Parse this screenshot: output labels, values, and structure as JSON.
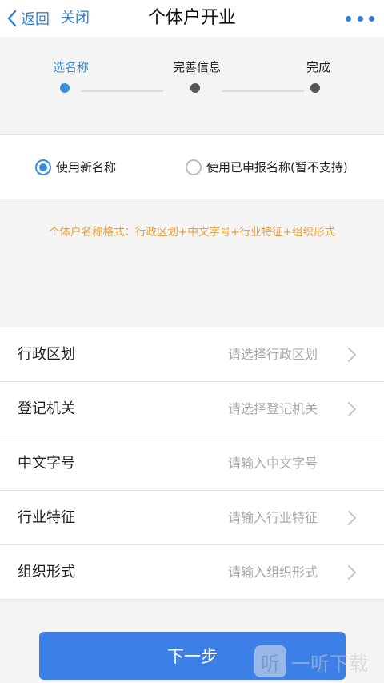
{
  "navbar": {
    "back_label": "返回",
    "close_label": "关闭",
    "title": "个体户开业"
  },
  "steps": [
    {
      "label": "选名称",
      "active": true
    },
    {
      "label": "完善信息",
      "active": false
    },
    {
      "label": "完成",
      "active": false
    }
  ],
  "name_options": {
    "new_name_label": "使用新名称",
    "declared_name_label": "使用已申报名称(暂不支持)",
    "selected": "new_name"
  },
  "format_hint": "个体户名称格式：行政区划+中文字号+行业特征+组织形式",
  "form": {
    "rows": [
      {
        "label": "行政区划",
        "placeholder": "请选择行政区划",
        "has_chevron": true
      },
      {
        "label": "登记机关",
        "placeholder": "请选择登记机关",
        "has_chevron": true
      },
      {
        "label": "中文字号",
        "placeholder": "请输入中文字号",
        "has_chevron": false
      },
      {
        "label": "行业特征",
        "placeholder": "请输入行业特征",
        "has_chevron": true
      },
      {
        "label": "组织形式",
        "placeholder": "请输入组织形式",
        "has_chevron": true
      }
    ]
  },
  "next_button_label": "下一步",
  "watermark": {
    "logo_char": "听",
    "text": "一听下载"
  },
  "colors": {
    "accent": "#3c7fe6",
    "link": "#2e7fd6",
    "hint": "#e6a23c",
    "placeholder": "#a9a9a9"
  }
}
